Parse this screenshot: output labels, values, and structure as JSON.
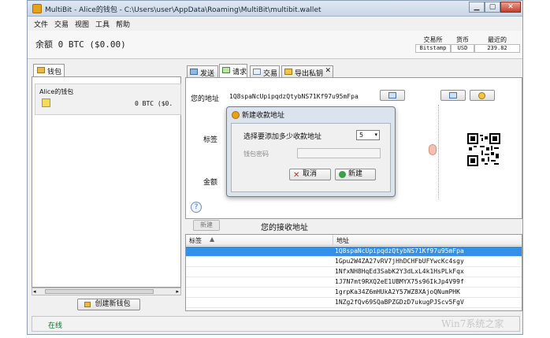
{
  "window": {
    "title": "MultiBit - Alice的钱包 - C:\\Users\\user\\AppData\\Roaming\\MultiBit\\multibit.wallet",
    "min": "▁",
    "max": "▢",
    "close": "✕"
  },
  "menu": [
    "文件",
    "交易",
    "视图",
    "工具",
    "帮助"
  ],
  "header": {
    "balance": "余额 0 BTC  ($0.00)",
    "ticker_headers": [
      "交易所",
      "货币",
      "最近的"
    ],
    "ticker_values": [
      "Bitstamp",
      "USD",
      "239.82"
    ]
  },
  "wallet_panel": {
    "tab_label": "钱包",
    "wallet_name": "Alice的钱包",
    "wallet_balance": "0 BTC   ($0.",
    "scroll_left": "◂",
    "scroll_right": "▸",
    "scroll_grip": "III",
    "create_button": "创建新钱包"
  },
  "tabs": [
    {
      "label": "发送"
    },
    {
      "label": "请求"
    },
    {
      "label": "交易"
    },
    {
      "label": "导出私钥"
    }
  ],
  "request": {
    "address_label": "您的地址",
    "address_value": "1Q8spaNcUpipqdzQtybNS71Kf97u95mFpa",
    "tag_label": "标签",
    "amount_label": "金额",
    "help": "?"
  },
  "address_list": {
    "new_button": "新建",
    "title": "您的接收地址",
    "col_tag": "标签",
    "col_address": "地址",
    "sort_indicator": "▲",
    "rows": [
      "1Q8spaNcUpipqdzQtybNS71Kf97u95mFpa",
      "1Gpu2W4ZA27vRV7jHhDCHFbUFYwcKc4sgy",
      "1NfxNH8HqEd3SabK2Y3dLxL4k1HsPLkFqx",
      "1J7N7mt9RXQ2eE1UBMYX75s96IkJp4V99f",
      "1grpKa34Z6mHUkA2Y57WZ8XAjoQNumPHK",
      "1NZg2fQv69SQaBPZGDzD7ukugPJScv5FgV"
    ]
  },
  "status": {
    "text": "在线"
  },
  "dialog": {
    "title": "新建收款地址",
    "question": "选择要添加多少收款地址",
    "count": "5",
    "caret": "▾",
    "password_label": "钱包密码",
    "cancel": "取消",
    "create": "新建",
    "cancel_icon": "✕"
  },
  "watermark": "Win7系统之家"
}
